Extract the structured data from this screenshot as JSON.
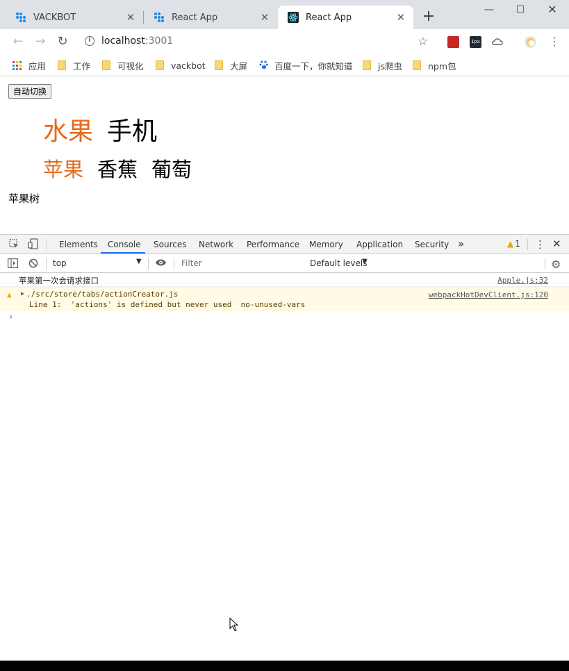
{
  "browser": {
    "tabs": [
      {
        "title": "VACKBOT",
        "active": false
      },
      {
        "title": "React App",
        "active": false
      },
      {
        "title": "React App",
        "active": true
      }
    ],
    "address": {
      "host": "localhost",
      "port": ":3001"
    },
    "bookmarks": [
      "应用",
      "工作",
      "可视化",
      "vackbot",
      "大屏",
      "百度一下，你就知道",
      "js爬虫",
      "npm包"
    ],
    "extensions": [
      {
        "name": "1px",
        "label": "1px"
      }
    ]
  },
  "page": {
    "auto_switch_button": "自动切换",
    "main_tabs": [
      "水果",
      "手机"
    ],
    "sub_tabs": [
      "苹果",
      "香蕉",
      "葡萄"
    ],
    "content": "苹果树",
    "accent_color": "#e66a1d"
  },
  "devtools": {
    "tabs": [
      "Elements",
      "Console",
      "Sources",
      "Network",
      "Performance",
      "Memory",
      "Application",
      "Security"
    ],
    "active_tab": "Console",
    "warning_count": "1",
    "context": "top",
    "filter_placeholder": "Filter",
    "levels": "Default levels",
    "messages": [
      {
        "type": "log",
        "text": "苹果第一次会请求接口",
        "source": "Apple.js:32"
      },
      {
        "type": "warning",
        "text": "./src/store/tabs/actionCreator.js",
        "detail": "Line 1:  'actions' is defined but never used  no-unused-vars",
        "source": "webpackHotDevClient.js:120"
      }
    ]
  }
}
